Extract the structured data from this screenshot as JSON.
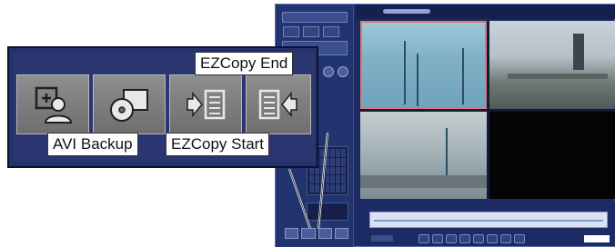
{
  "callouts": {
    "avi_backup": "AVI Backup",
    "ezcopy_start": "EZCopy Start",
    "ezcopy_end": "EZCopy End"
  },
  "toolbar_icons": [
    "avi-backup-icon",
    "disc-backup-icon",
    "ezcopy-start-icon",
    "ezcopy-end-icon"
  ],
  "colors": {
    "app_background": "#1c2b63",
    "toolbar_background": "#26306a",
    "button_gray": "#7a7a7a",
    "selected_camera_border": "#e0766f"
  }
}
